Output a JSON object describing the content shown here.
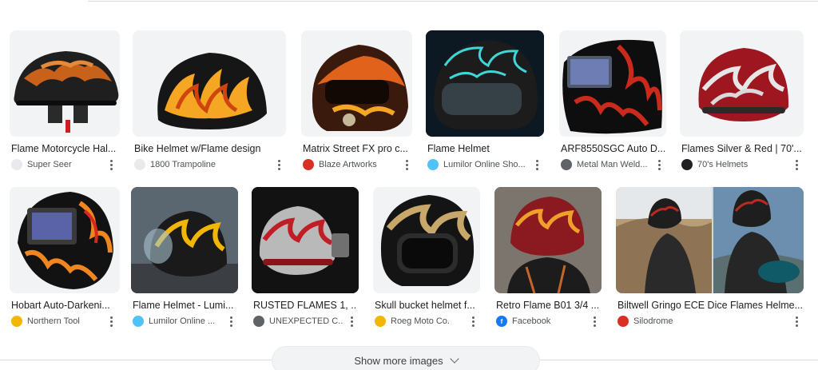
{
  "results": [
    {
      "title": "Flame Motorcycle Hal...",
      "source": "Super Seer",
      "favicon_icon": "super-seer-favicon",
      "favicon_color": "#e8eaed"
    },
    {
      "title": "Bike Helmet w/Flame design",
      "source": "1800 Trampoline",
      "favicon_icon": "trampoline-favicon",
      "favicon_color": "#e8eaed"
    },
    {
      "title": "Matrix Street FX pro c...",
      "source": "Blaze Artworks",
      "favicon_icon": "blaze-artworks-favicon",
      "favicon_color": "#d93025"
    },
    {
      "title": "Flame Helmet",
      "source": "Lumilor Online Sho...",
      "favicon_icon": "lumilor-favicon",
      "favicon_color": "#4fc3f7"
    },
    {
      "title": "ARF8550SGC Auto D...",
      "source": "Metal Man Weld...",
      "favicon_icon": "metal-man-favicon",
      "favicon_color": "#5f6368"
    },
    {
      "title": "Flames Silver & Red | 70'...",
      "source": "70's Helmets",
      "favicon_icon": "seventies-helmets-favicon",
      "favicon_color": "#202124"
    },
    {
      "title": "Hobart Auto-Darkeni...",
      "source": "Northern Tool",
      "favicon_icon": "northern-tool-favicon",
      "favicon_color": "#f2b705"
    },
    {
      "title": "Flame Helmet - Lumi...",
      "source": "Lumilor Online ...",
      "favicon_icon": "lumilor-favicon",
      "favicon_color": "#4fc3f7"
    },
    {
      "title": "RUSTED FLAMES 1, ...",
      "source": "UNEXPECTED C...",
      "favicon_icon": "unexpected-favicon",
      "favicon_color": "#5f6368"
    },
    {
      "title": "Skull bucket helmet f...",
      "source": "Roeg Moto Co.",
      "favicon_icon": "roeg-moto-favicon",
      "favicon_color": "#f2b705"
    },
    {
      "title": "Retro Flame B01 3/4 ...",
      "source": "Facebook",
      "favicon_icon": "facebook-favicon",
      "favicon_color": "#1877f2"
    },
    {
      "title": "Biltwell Gringo ECE Dice Flames Helme...",
      "source": "Silodrome",
      "favicon_icon": "silodrome-favicon",
      "favicon_color": "#d93025"
    }
  ],
  "show_more": {
    "label": "Show more images",
    "icon": "chevron-down-icon"
  }
}
